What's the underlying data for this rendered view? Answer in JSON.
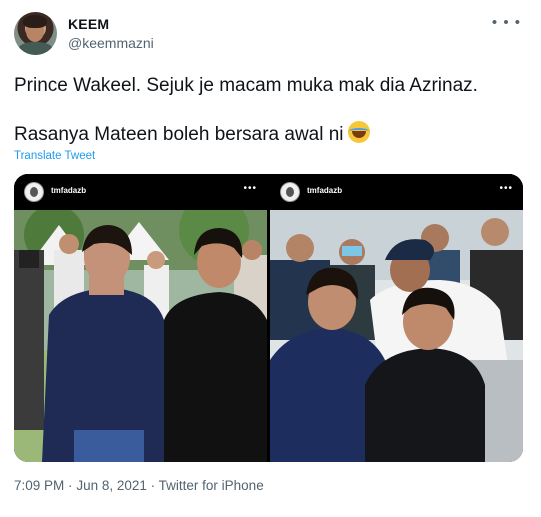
{
  "author": {
    "name": "KEEM",
    "handle": "@keemmazni"
  },
  "tweet": {
    "line1": "Prince Wakeel. Sejuk je macam muka mak dia Azrinaz.",
    "line2": "Rasanya Mateen boleh bersara awal ni",
    "emoji": "face-with-tears-of-joy",
    "translate_label": "Translate Tweet"
  },
  "media": {
    "images": [
      {
        "ig_username": "tmfadazb"
      },
      {
        "ig_username": "tmfadazb"
      }
    ]
  },
  "meta": {
    "time": "7:09 PM",
    "date": "Jun 8, 2021",
    "source": "Twitter for iPhone",
    "separator": "·"
  },
  "icons": {
    "more": "more-horizontal-icon"
  },
  "colors": {
    "link": "#1d9bf0",
    "secondary_text": "#536471",
    "primary_text": "#0f1419"
  }
}
